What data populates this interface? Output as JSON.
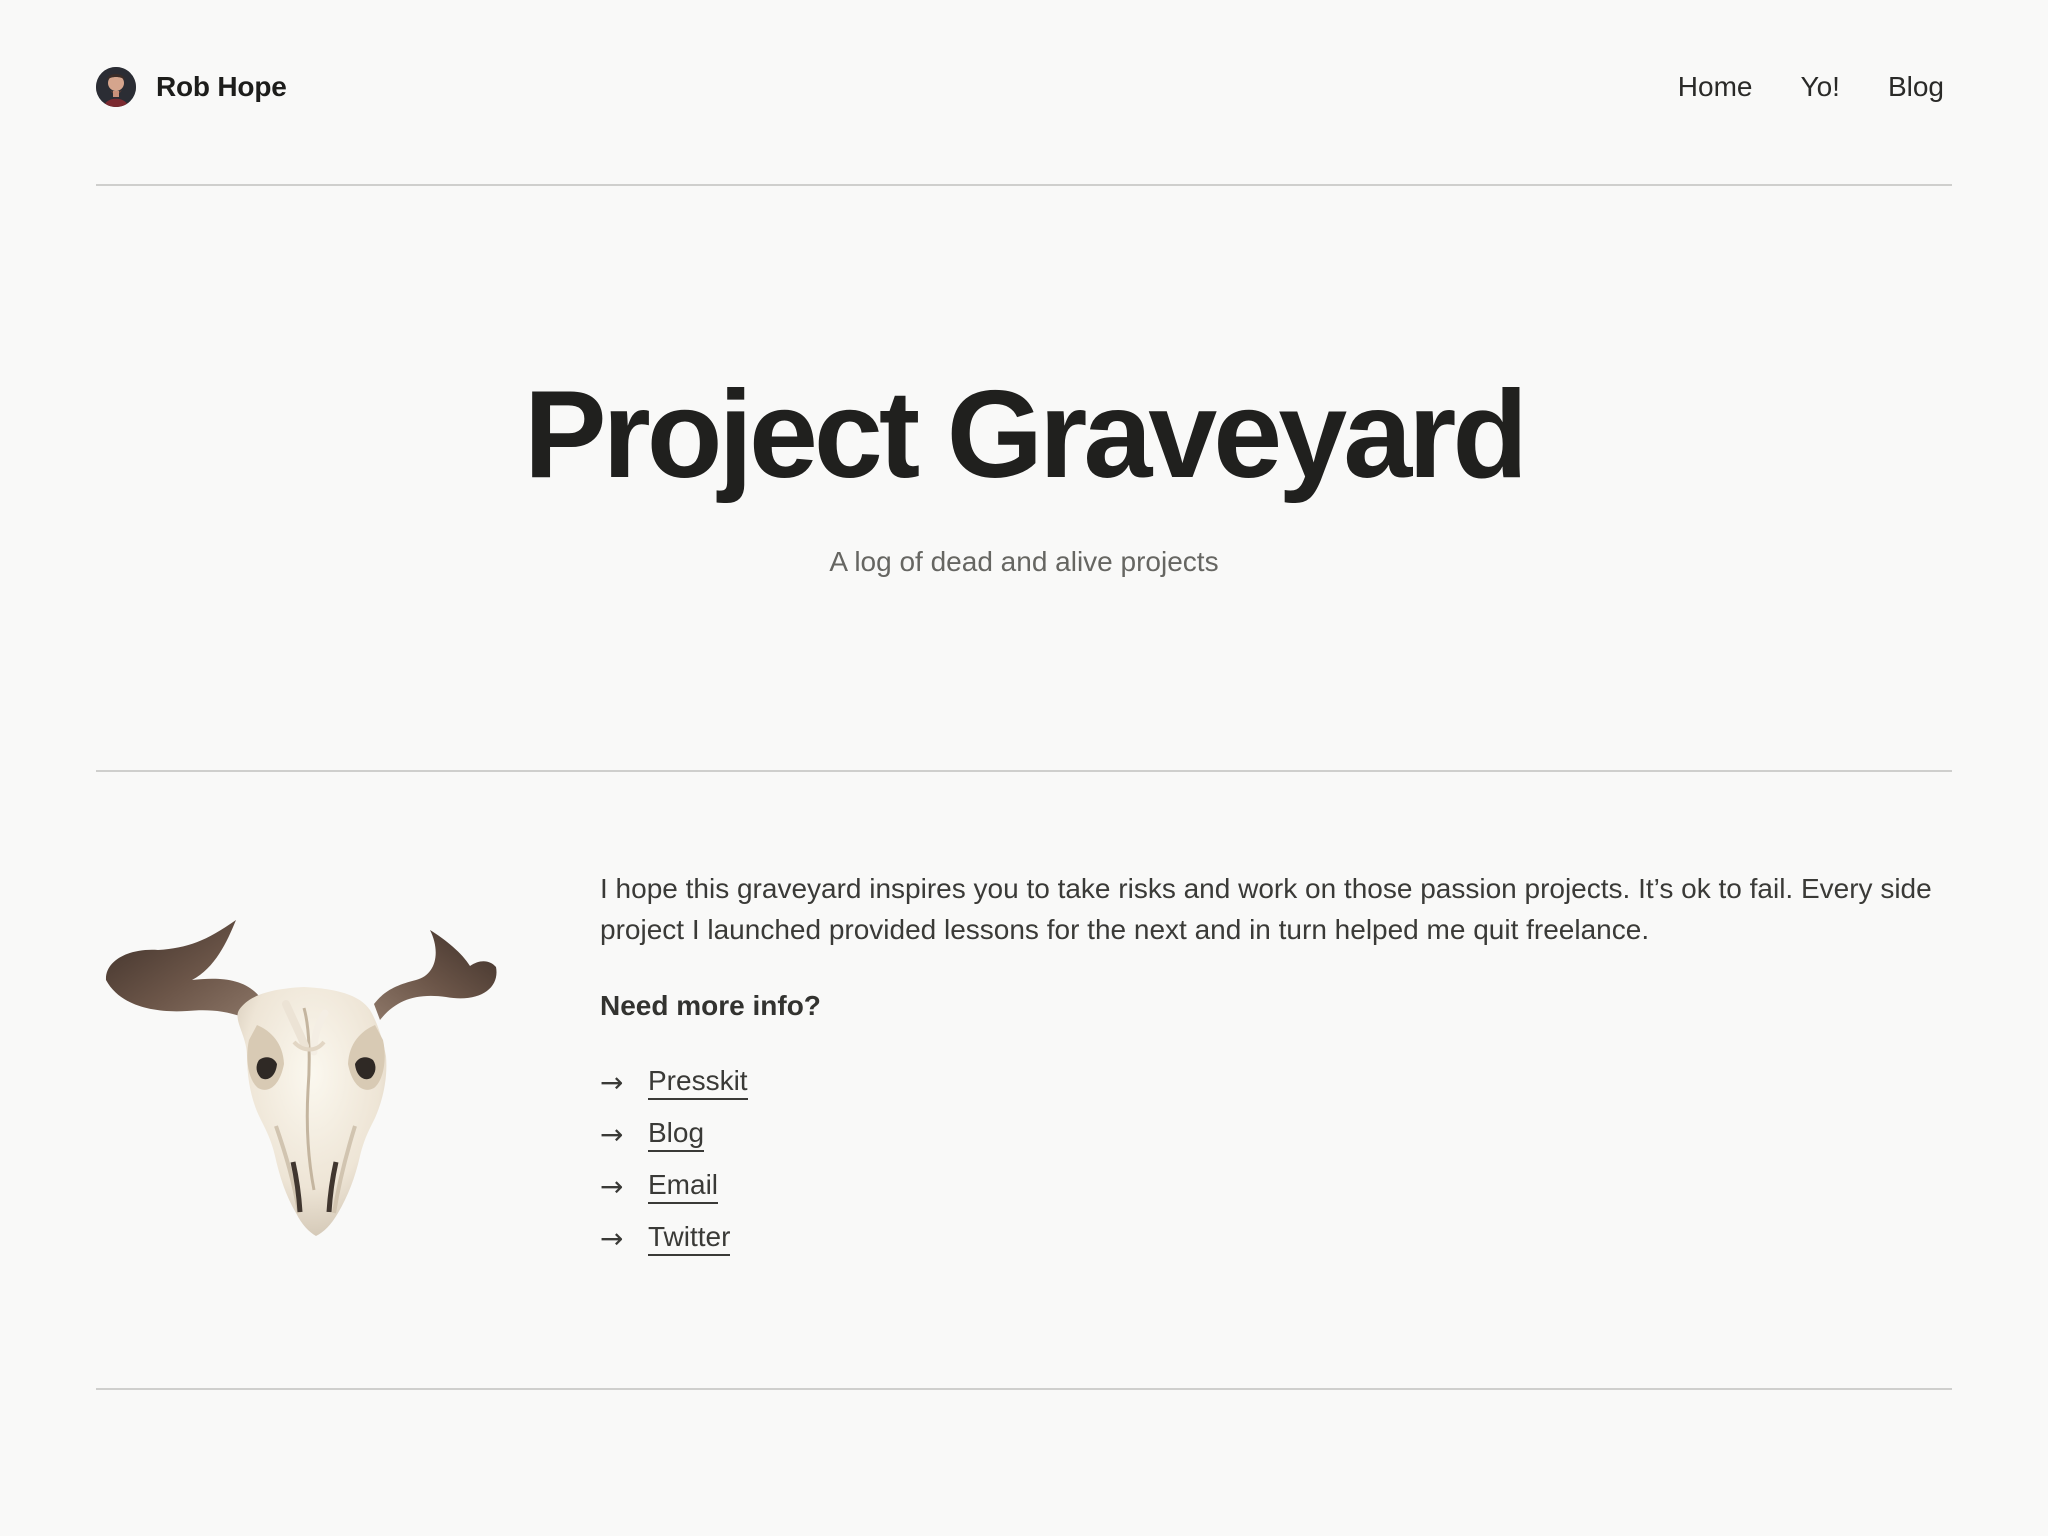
{
  "site": {
    "name": "Rob Hope",
    "nav": [
      {
        "label": "Home"
      },
      {
        "label": "Yo!"
      },
      {
        "label": "Blog"
      }
    ]
  },
  "hero": {
    "title": "Project Graveyard",
    "subtitle": "A log of dead and alive projects"
  },
  "intro": {
    "text": "I hope this graveyard inspires you to take risks and work on those passion projects. It’s ok to fail. Every side project I launched provided lessons for the next and in turn helped me quit freelance.",
    "more_heading": "Need more info?",
    "arrow": "→",
    "links": [
      {
        "label": "Presskit"
      },
      {
        "label": "Blog"
      },
      {
        "label": "Email"
      },
      {
        "label": "Twitter"
      }
    ]
  }
}
